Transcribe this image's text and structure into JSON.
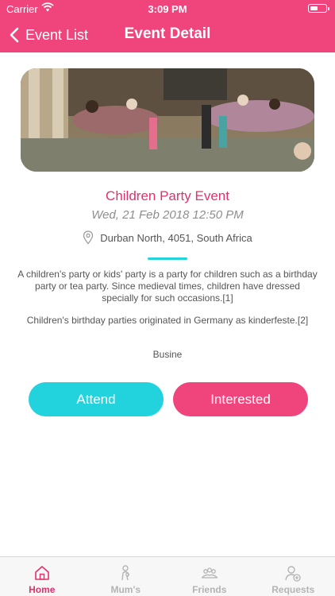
{
  "status_bar": {
    "carrier": "Carrier",
    "time": "3:09 PM"
  },
  "nav": {
    "back_label": "Event List",
    "title": "Event Detail"
  },
  "event": {
    "title": "Children Party Event",
    "datetime": "Wed, 21 Feb 2018 12:50 PM",
    "location": "Durban North, 4051, South Africa",
    "description": [
      "A children's party or kids' party is a party for children such as a birthday party or tea party. Since medieval times, children have dressed specially for such occasions.[1]",
      "Children's birthday parties originated in Germany as kinderfeste.[2]",
      "Busine"
    ]
  },
  "actions": {
    "attend_label": "Attend",
    "interested_label": "Interested"
  },
  "tabs": [
    {
      "label": "Home",
      "icon": "home-icon",
      "active": true
    },
    {
      "label": "Mum's",
      "icon": "mother-icon",
      "active": false
    },
    {
      "label": "Friends",
      "icon": "friends-icon",
      "active": false
    },
    {
      "label": "Requests",
      "icon": "add-user-icon",
      "active": false
    }
  ],
  "colors": {
    "primary": "#f0457c",
    "accent": "#22d3de",
    "title": "#e3306e"
  }
}
